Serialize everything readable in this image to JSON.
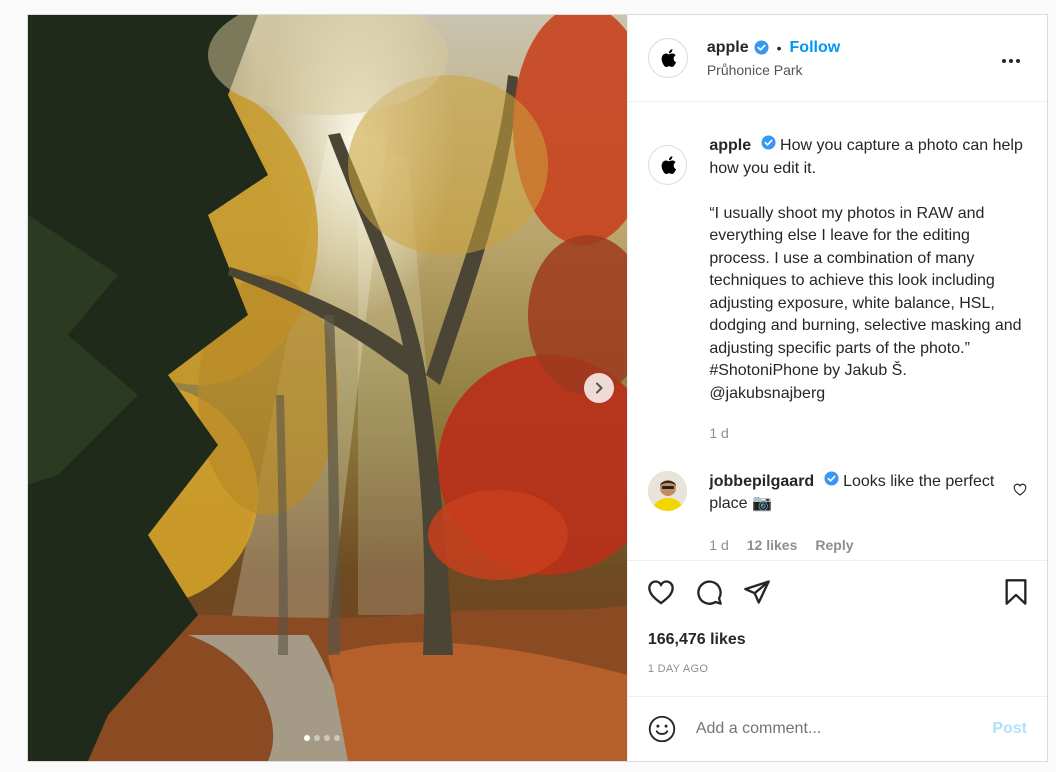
{
  "post": {
    "author": "apple",
    "follow_label": "Follow",
    "separator": "•",
    "location": "Průhonice Park"
  },
  "caption": {
    "username": "apple",
    "text": "How you capture a photo can help how you edit it.\n\n“I usually shoot my photos in RAW and everything else I leave for the editing process. I use a combination of many techniques to achieve this look including adjusting exposure, white balance, HSL, dodging and burning, selective masking and adjusting specific parts of the photo.” #ShotoniPhone by Jakub Š. @jakubsnajberg",
    "time": "1 d"
  },
  "comment": {
    "username": "jobbepilgaard",
    "text": "Looks like the perfect place 📷",
    "time": "1 d",
    "likes": "12 likes",
    "reply": "Reply"
  },
  "stats": {
    "likes": "166,476 likes",
    "date": "1 DAY AGO"
  },
  "composer": {
    "placeholder": "Add a comment...",
    "post_label": "Post"
  },
  "carousel": {
    "slides": 4,
    "active": 1
  },
  "colors": {
    "accent": "#0095f6",
    "verified": "#3897f0",
    "muted": "#8e8e8e"
  },
  "icons": [
    "apple-logo-icon",
    "verified-badge-icon",
    "more-options-icon",
    "chevron-right-icon",
    "heart-icon",
    "comment-icon",
    "share-icon",
    "bookmark-icon",
    "emoji-icon"
  ]
}
